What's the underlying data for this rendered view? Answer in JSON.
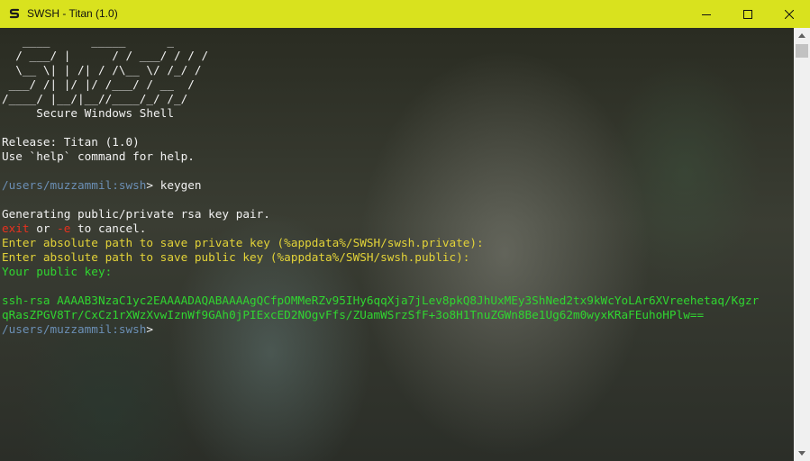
{
  "window": {
    "title": "SWSH - Titan (1.0)",
    "accent_color": "#d9e21e"
  },
  "banner": {
    "line1": "   ____      _____      _",
    "line2": "  / ___/ |      / / ___/ / / /",
    "line3": "  \\__ \\| | /| / /\\__ \\/ /_/ /",
    "line4": " ___/ /| |/ |/ /___/ / __  /",
    "line5": "/____/ |__/|__//____/_/ /_/",
    "tagline": "     Secure Windows Shell"
  },
  "release": "Release: Titan (1.0)",
  "help_hint": "Use `help` command for help.",
  "prompt": {
    "path": "/users/muzzammil:",
    "name": "swsh",
    "symbol": "> "
  },
  "command": "keygen",
  "generating": "Generating public/private rsa key pair.",
  "cancel": {
    "word_exit": "exit",
    "or": " or ",
    "flag": "-e",
    "rest": " to cancel."
  },
  "private_prompt": "Enter absolute path to save private key (%appdata%/SWSH/swsh.private):",
  "public_prompt": "Enter absolute path to save public key (%appdata%/SWSH/swsh.public):",
  "public_key_label": "Your public key:",
  "key_line1": "ssh-rsa AAAAB3NzaC1yc2EAAAADAQABAAAAgQCfpOMMeRZv95IHy6qqXja7jLev8pkQ8JhUxMEy3ShNed2tx9kWcYoLAr6XVreehetaq/Kgzr",
  "key_line2": "qRasZPGV8Tr/CxCz1rXWzXvwIznWf9GAh0jPIExcED2NOgvFfs/ZUamWSrzSfF+3o8H1TnuZGWn8Be1Ug62m0wyxKRaFEuhoHPlw==",
  "colors": {
    "path": "#6b8fb5",
    "red": "#e8311f",
    "yellow": "#e3d338",
    "green": "#30d630"
  },
  "icons": [
    "app-icon",
    "minimize-icon",
    "maximize-icon",
    "close-icon",
    "scroll-up-arrow-icon",
    "scroll-down-arrow-icon"
  ]
}
